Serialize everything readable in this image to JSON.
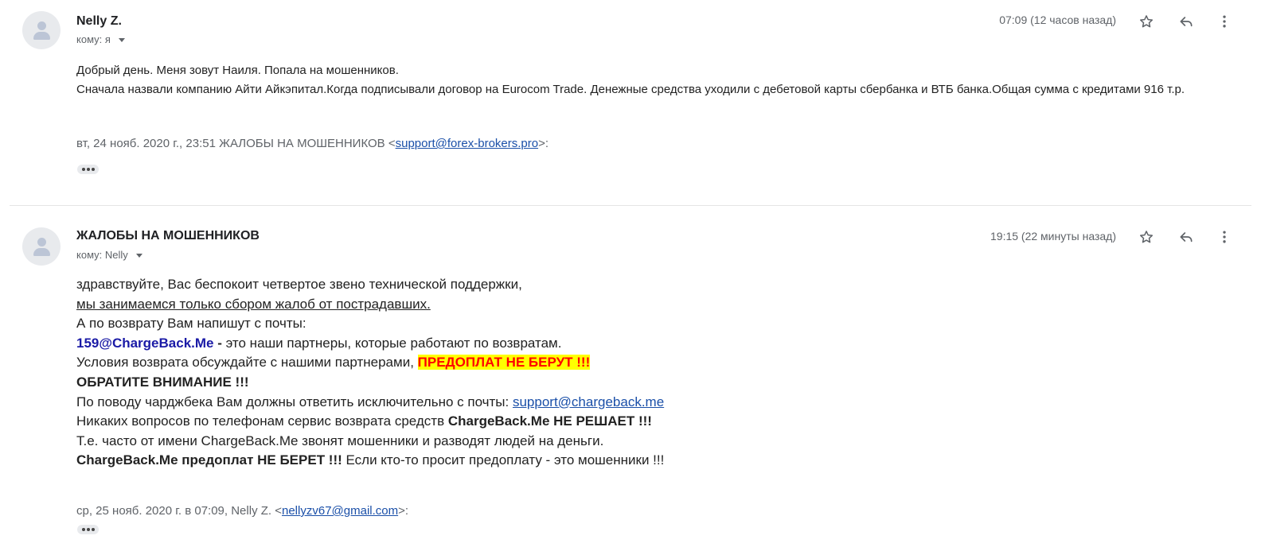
{
  "messages": [
    {
      "sender": "Nelly Z.",
      "to_label": "кому: я",
      "time": "07:09 (12 часов назад)",
      "body": {
        "line1": "Добрый день. Меня зовут Наиля. Попала на мошенников.",
        "line2": "Сначала назвали компанию Айти Айкэпитал.Когда подписывали договор на Eurocom Trade. Денежные средства уходили с дебетовой карты сбербанка и ВТБ банка.Общая сумма с кредитами 916 т.р."
      },
      "quote": {
        "prefix": "вт, 24 нояб. 2020 г., 23:51 ЖАЛОБЫ НА МОШЕННИКОВ <",
        "email": "support@forex-brokers.pro",
        "suffix": ">:"
      }
    },
    {
      "sender": "ЖАЛОБЫ НА МОШЕННИКОВ",
      "to_label": "кому: Nelly",
      "time": "19:15 (22 минуты назад)",
      "body": {
        "l1": "здравствуйте, Вас беспокоит четвертое звено технической поддержки,",
        "l2": "мы занимаемся только сбором жалоб от пострадавших.",
        "l3": "А по возврату Вам напишут с почты:",
        "l4_bold": "159@ChargeBack.Me",
        "l4_sep": " - ",
        "l4_rest": "это наши партнеры, которые работают по возвратам.",
        "l5": "Условия возврата обсуждайте с нашими партнерами, ",
        "l5_highlight": "ПРЕДОПЛАТ НЕ БЕРУТ !!!",
        "l6": "ОБРАТИТЕ ВНИМАНИЕ !!!",
        "l7": "По поводу чарджбека Вам должны ответить исключительно с почты: ",
        "l7_email": "support@chargeback.me",
        "l8": "Никаких вопросов по телефонам сервис возврата средств ",
        "l8_bold": "ChargeBack.Me НЕ РЕШАЕТ !!!",
        "l9": "Т.е. часто от имени ChargeBack.Me звонят мошенники и разводят людей на деньги.",
        "l10_bold": "ChargeBack.Me предоплат НЕ БЕРЕТ !!!",
        "l10_rest": " Если кто-то просит предоплату - это мошенники !!!"
      },
      "quote": {
        "prefix": "ср, 25 нояб. 2020 г. в 07:09, Nelly Z. <",
        "email": "nellyzv67@gmail.com",
        "suffix": ">:"
      }
    }
  ],
  "icons": {
    "star": "star-outline-icon",
    "reply": "reply-icon",
    "more": "more-vert-icon",
    "avatar": "person-icon"
  }
}
